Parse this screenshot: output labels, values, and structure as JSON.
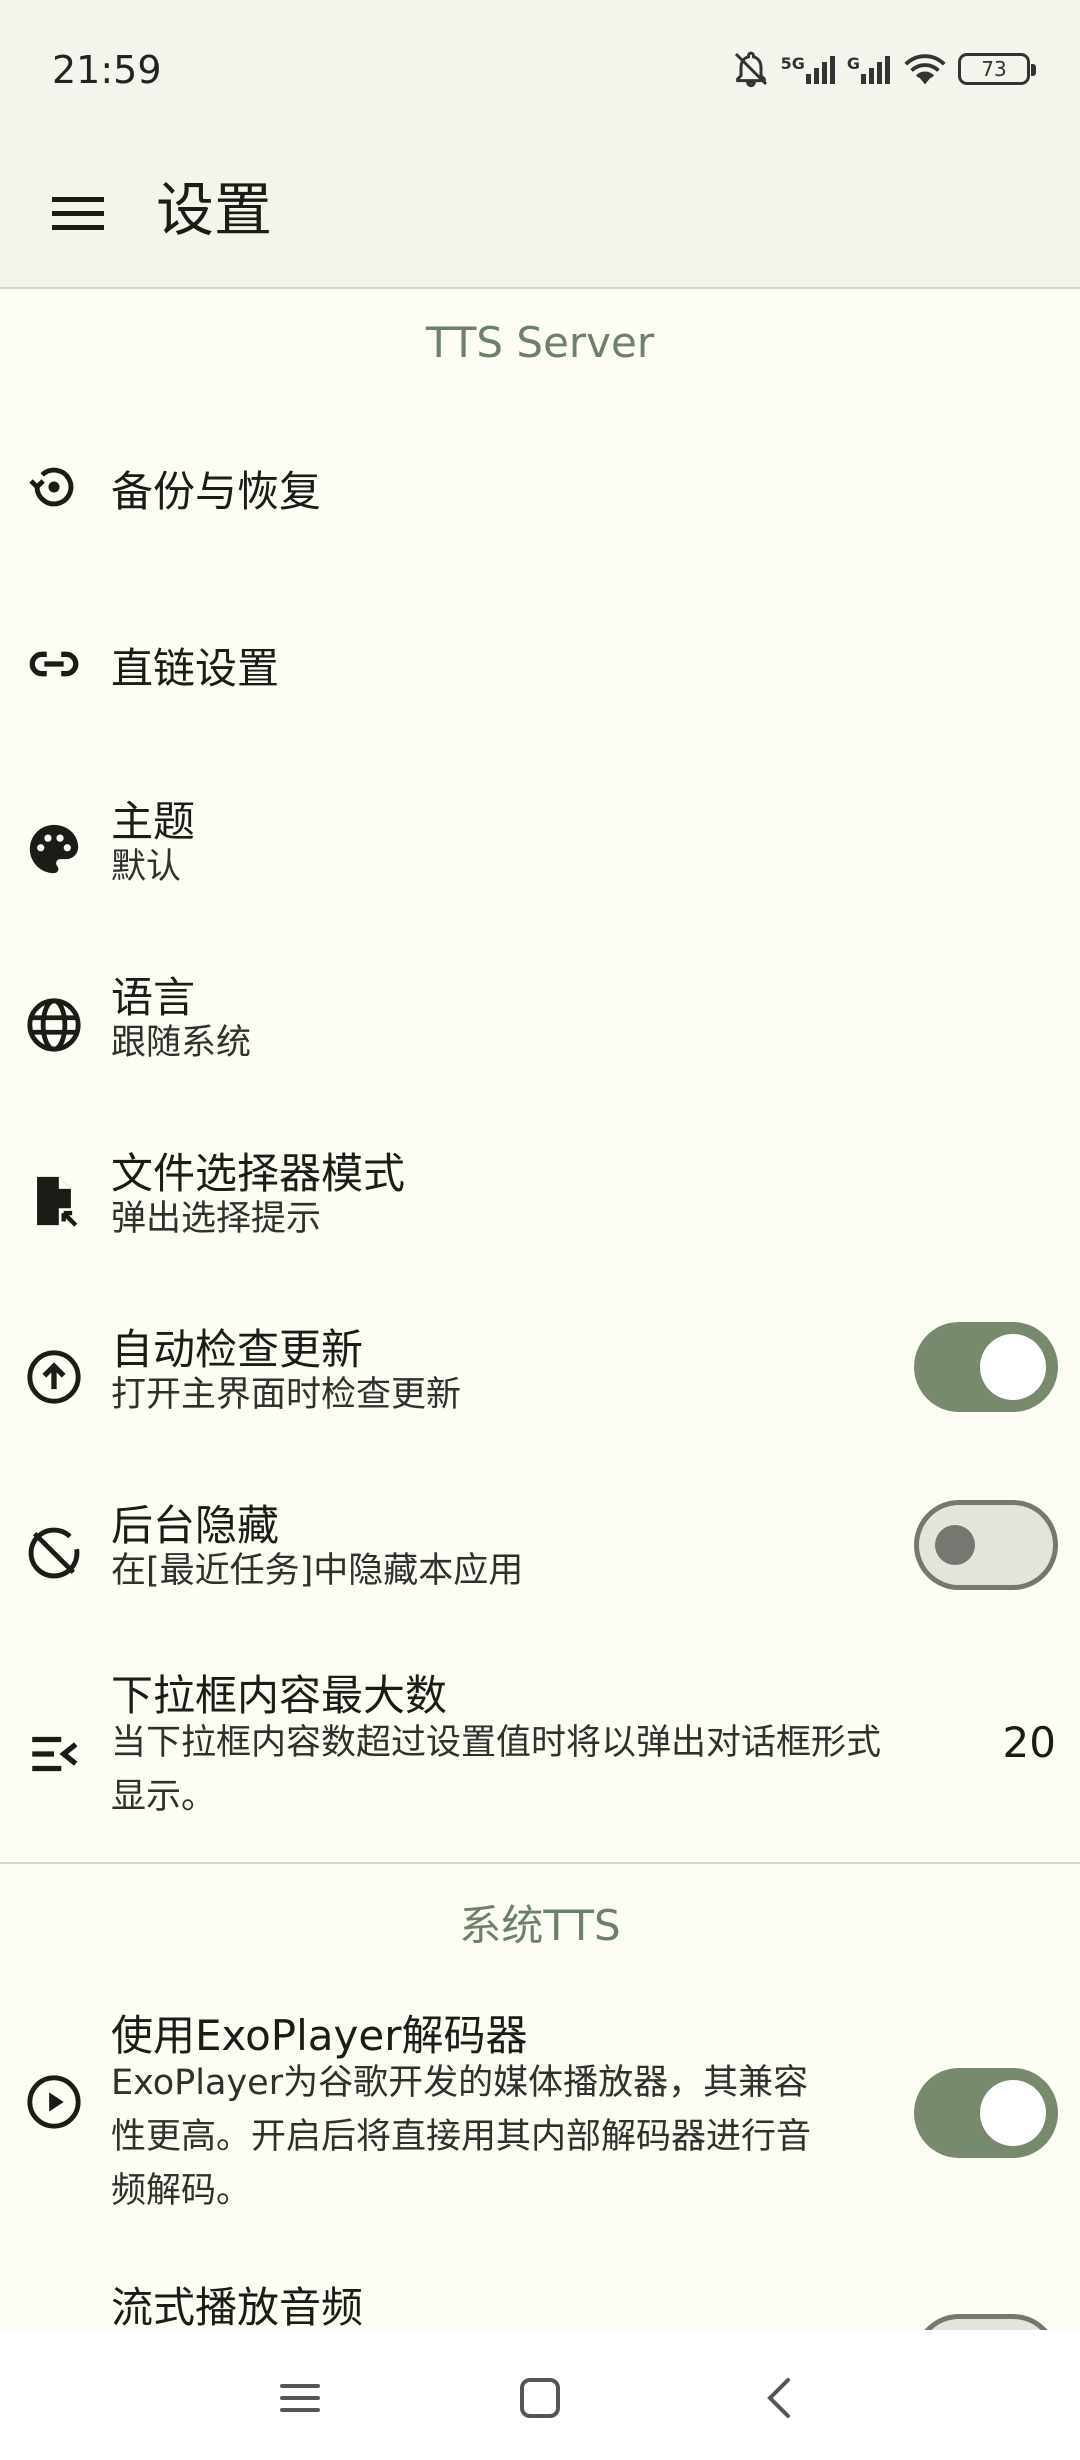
{
  "status_bar": {
    "time": "21:59",
    "network_5g": "5G",
    "network_g": "G",
    "battery": "73"
  },
  "app_bar": {
    "title": "设置"
  },
  "sections": [
    {
      "header": "TTS Server"
    },
    {
      "header": "系统TTS"
    }
  ],
  "items": [
    {
      "title": "备份与恢复",
      "icon": "backup-restore-icon"
    },
    {
      "title": "直链设置",
      "icon": "link-icon"
    },
    {
      "title": "主题",
      "summary": "默认",
      "icon": "palette-icon"
    },
    {
      "title": "语言",
      "summary": "跟随系统",
      "icon": "globe-icon"
    },
    {
      "title": "文件选择器模式",
      "summary": "弹出选择提示",
      "icon": "file-open-icon"
    },
    {
      "title": "自动检查更新",
      "summary": "打开主界面时检查更新",
      "icon": "upload-circle-icon",
      "switch": true
    },
    {
      "title": "后台隐藏",
      "summary": "在[最近任务]中隐藏本应用",
      "icon": "hide-icon",
      "switch": false
    },
    {
      "title": "下拉框内容最大数",
      "summary_line1": "当下拉框内容数超过设置值时将以弹出对话框形式",
      "summary_line2": "显示。",
      "value": "20",
      "icon": "list-collapse-icon"
    },
    {
      "title": "使用ExoPlayer解码器",
      "summary_line1": "ExoPlayer为谷歌开发的媒体播放器，其兼容",
      "summary_line2": "性更高。开启后将直接用其内部解码器进行音",
      "summary_line3": "频解码。",
      "icon": "play-circle-icon",
      "switch": true
    },
    {
      "title": "流式播放音频",
      "icon": "stream-icon"
    }
  ],
  "colors": {
    "accent": "#778a6e",
    "section_header": "#6d8068",
    "background": "#fdfdf5",
    "app_bar": "#f4f4ec"
  }
}
